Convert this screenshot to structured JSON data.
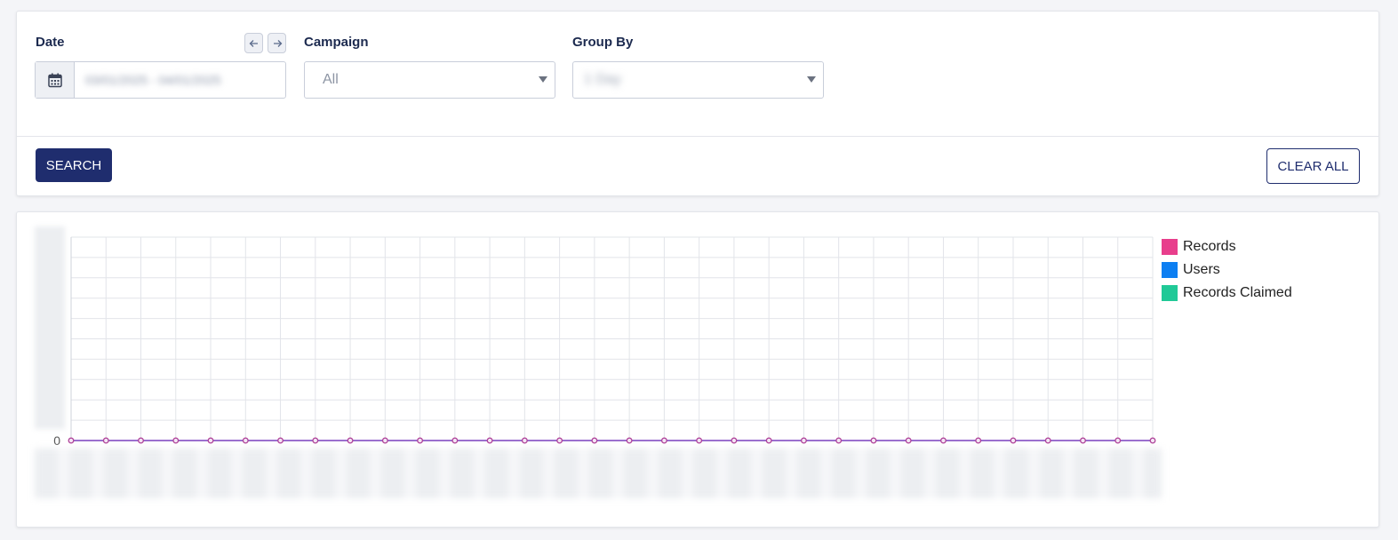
{
  "filters": {
    "date_label": "Date",
    "date_value": "03/01/2025 - 04/01/2025",
    "campaign_label": "Campaign",
    "campaign_value": "All",
    "group_by_label": "Group By",
    "group_by_value": "1 Day"
  },
  "actions": {
    "search_label": "SEARCH",
    "clear_label": "CLEAR ALL"
  },
  "icons": {
    "prev": "arrow-left-icon",
    "next": "arrow-right-icon",
    "calendar": "calendar-icon"
  },
  "colors": {
    "primary": "#1f2d6e",
    "records": "#e83e8c",
    "users": "#0d7ff2",
    "records_claimed": "#20c997",
    "line": "#9b6fcf"
  },
  "chart_data": {
    "type": "line",
    "ytick_zero": "0",
    "point_count": 32,
    "series": [
      {
        "name": "Records",
        "color": "#e83e8c",
        "values": [
          0,
          0,
          0,
          0,
          0,
          0,
          0,
          0,
          0,
          0,
          0,
          0,
          0,
          0,
          0,
          0,
          0,
          0,
          0,
          0,
          0,
          0,
          0,
          0,
          0,
          0,
          0,
          0,
          0,
          0,
          0,
          0
        ]
      },
      {
        "name": "Users",
        "color": "#0d7ff2",
        "values": [
          0,
          0,
          0,
          0,
          0,
          0,
          0,
          0,
          0,
          0,
          0,
          0,
          0,
          0,
          0,
          0,
          0,
          0,
          0,
          0,
          0,
          0,
          0,
          0,
          0,
          0,
          0,
          0,
          0,
          0,
          0,
          0
        ]
      },
      {
        "name": "Records Claimed",
        "color": "#20c997",
        "values": [
          0,
          0,
          0,
          0,
          0,
          0,
          0,
          0,
          0,
          0,
          0,
          0,
          0,
          0,
          0,
          0,
          0,
          0,
          0,
          0,
          0,
          0,
          0,
          0,
          0,
          0,
          0,
          0,
          0,
          0,
          0,
          0
        ]
      }
    ],
    "grid": true,
    "legend": "right"
  }
}
